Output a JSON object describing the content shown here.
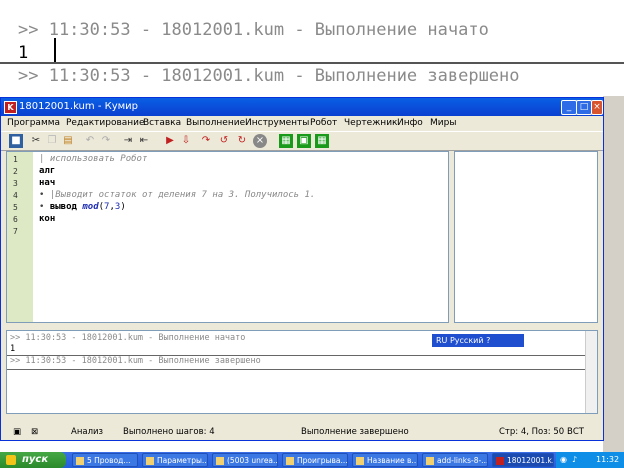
{
  "zoom": {
    "line1": ">> 11:30:53 - 18012001.kum - Выполнение начато",
    "line2": "1",
    "line3": ">> 11:30:53 - 18012001.kum - Выполнение завершено"
  },
  "window": {
    "icon_letter": "K",
    "title": "18012001.kum - Кумир",
    "controls": {
      "minimize": "_",
      "maximize": "□",
      "close": "×"
    }
  },
  "menu": [
    "Программа",
    "Редактирование",
    "Вставка",
    "Выполнение",
    "Инструменты",
    "Робот",
    "Чертежник",
    "Инфо",
    "Миры"
  ],
  "editor": {
    "line_numbers": [
      "1",
      "2",
      "3",
      "4",
      "5",
      "6",
      "7"
    ],
    "lines": {
      "l1": "| использовать Робот",
      "l2": "алг",
      "l3": "нач",
      "l4": "|Выводит остаток от деления 7 на 3. Получилось 1.",
      "l5_kw": "вывод",
      "l5_fn": "mod",
      "l5_args_open": "(",
      "l5_a": "7",
      "l5_comma": ",",
      "l5_b": "3",
      "l5_close": ")",
      "l6": "кон"
    }
  },
  "output": {
    "line1": ">> 11:30:53 - 18012001.kum - Выполнение начато",
    "line2": "1",
    "line3": ">> 11:30:53 - 18012001.kum - Выполнение завершено"
  },
  "status": {
    "analysis": "Анализ",
    "steps": "Выполнено шагов: 4",
    "state": "Выполнение завершено",
    "position": "Стр: 4, Поз: 50",
    "mode": "ВСТ"
  },
  "language_bar": {
    "label": "RU Русский"
  },
  "taskbar": {
    "start": "пуск",
    "tasks": [
      "5 Провод...",
      "Параметры...",
      "(5003 unrea...",
      "Проигрыва...",
      "Название в...",
      "add-links-8-...",
      "18012001.k..."
    ],
    "clock": "11:32"
  },
  "colors": {
    "titlebar": "#0a5fe5",
    "gutter": "#dde9c4",
    "keyword_blue": "#1a2ab0",
    "comment_gray": "#888888"
  }
}
